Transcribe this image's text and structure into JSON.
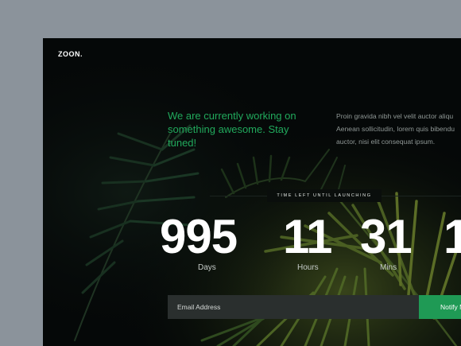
{
  "brand": {
    "logo": "ZOON."
  },
  "hero": {
    "headline": "We are currently working on something awesome. Stay tuned!",
    "description_lines": [
      "Proin gravida nibh vel velit auctor aliqu",
      "Aenean sollicitudin, lorem quis bibendu",
      "auctor, nisi elit consequat ipsum."
    ]
  },
  "countdown": {
    "label": "TIME LEFT UNTIL LAUNCHING",
    "units": [
      {
        "value": "995",
        "label": "Days"
      },
      {
        "value": "11",
        "label": "Hours"
      },
      {
        "value": "31",
        "label": "Mins"
      },
      {
        "value": "1",
        "label": ""
      }
    ]
  },
  "subscribe": {
    "placeholder": "Email Address",
    "button_label": "Notify M"
  },
  "colors": {
    "accent": "#21a95c",
    "button": "#1f9a55",
    "background": "#050808",
    "page": "#8b939b"
  }
}
